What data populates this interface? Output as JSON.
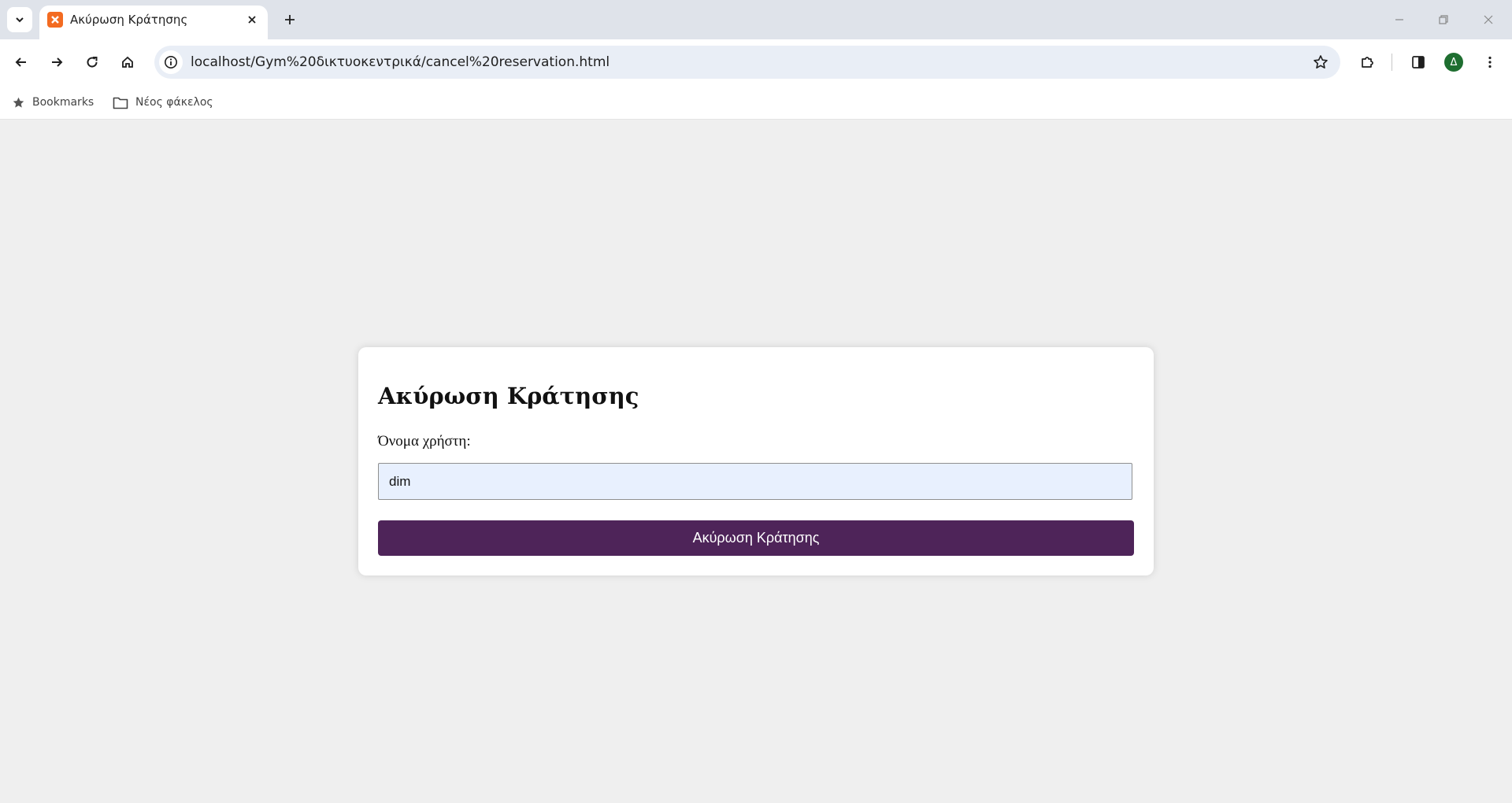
{
  "browser": {
    "tab": {
      "title": "Ακύρωση Κράτησης"
    },
    "url": "localhost/Gym%20δικτυοκεντρικά/cancel%20reservation.html",
    "profile_initial": "Δ",
    "bookmarks_bar": [
      {
        "label": "Bookmarks",
        "icon": "star-icon"
      },
      {
        "label": "Νέος φάκελος",
        "icon": "folder-icon"
      }
    ]
  },
  "form": {
    "title": "Ακύρωση Κράτησης",
    "username_label": "Όνομα χρήστη:",
    "username_value": "dim",
    "submit_label": "Ακύρωση Κράτησης"
  },
  "colors": {
    "accent": "#4e2459",
    "page_background": "#efefef",
    "input_autofill": "#e8f0fe",
    "favicon": "#f36b21",
    "avatar": "#1e6e30"
  }
}
